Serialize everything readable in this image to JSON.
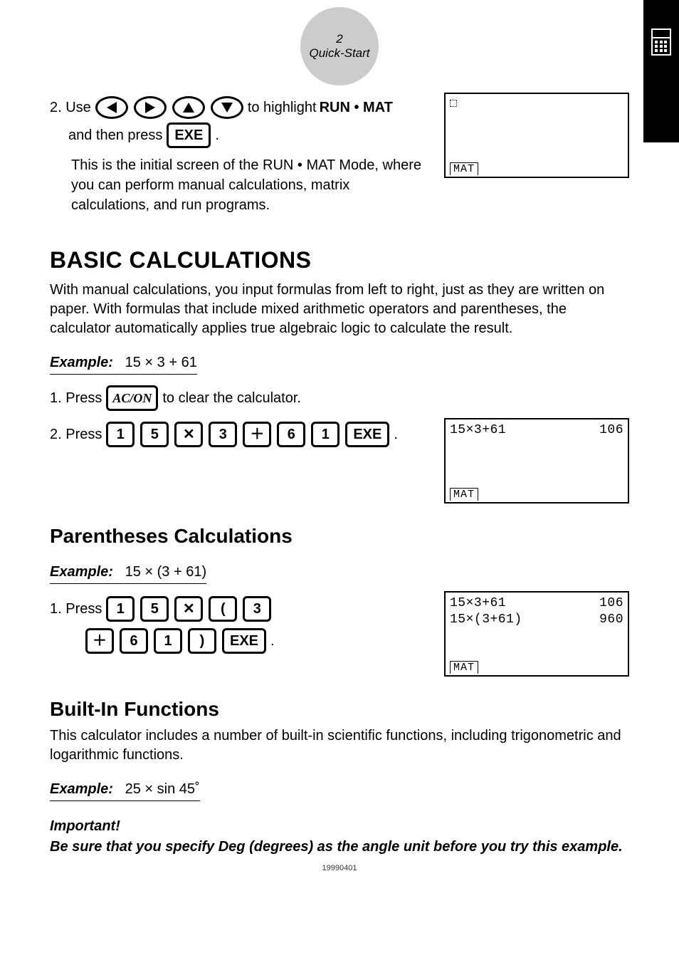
{
  "header": {
    "page_number": "2",
    "label": "Quick-Start"
  },
  "step2": {
    "prefix": "2.  Use",
    "mid_text": "to highlight",
    "highlight": "RUN • MAT",
    "line2a": "and then press",
    "exe": "EXE",
    "period": ".",
    "desc": "This is the initial screen of the RUN • MAT Mode, where you can perform manual calculations, matrix calculations, and run programs."
  },
  "screen0": {
    "mat": "MAT"
  },
  "basic": {
    "title": "BASIC CALCULATIONS",
    "body": "With manual calculations, you input formulas from left to right, just as they are written on paper. With formulas that include mixed arithmetic operators and parentheses, the calculator automatically applies true algebraic logic to calculate the result.",
    "example_label": "Example:",
    "example_expr": "15 × 3 + 61",
    "step1_prefix": "1.  Press",
    "acon": "AC/ON",
    "step1_suffix": "to clear the calculator.",
    "step2_prefix": "2.  Press",
    "keys": {
      "k1": "1",
      "k5": "5",
      "kx": "✕",
      "k3": "3",
      "kp": "＋",
      "k6": "6",
      "k1b": "1",
      "exe": "EXE"
    },
    "period": "."
  },
  "screen1": {
    "l1_left": "15×3+61",
    "l1_right": "106",
    "mat": "MAT"
  },
  "paren": {
    "title": "Parentheses Calculations",
    "example_label": "Example:",
    "example_expr": "15 × (3 + 61)",
    "step1_prefix": "1.  Press",
    "keys": {
      "k1": "1",
      "k5": "5",
      "kx": "✕",
      "klp": "(",
      "k3": "3",
      "kp": "＋",
      "k6": "6",
      "k1b": "1",
      "krp": ")",
      "exe": "EXE"
    },
    "period": "."
  },
  "screen2": {
    "l1_left": "15×3+61",
    "l1_right": "106",
    "l2_left": "15×(3+61)",
    "l2_right": "960",
    "mat": "MAT"
  },
  "builtin": {
    "title": "Built-In Functions",
    "body": "This calculator includes a number of built-in scientific functions, including trigonometric and logarithmic functions.",
    "example_label": "Example:",
    "example_expr": "25 × sin 45˚",
    "important_label": "Important!",
    "important_text": "Be sure that you specify Deg (degrees) as the angle unit before you try this example."
  },
  "footer": {
    "code": "19990401"
  }
}
